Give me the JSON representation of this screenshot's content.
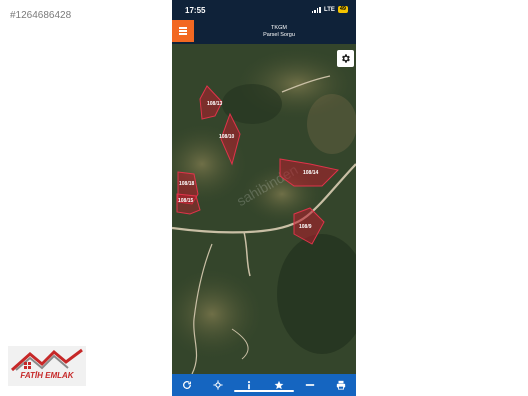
{
  "listing_id": "#1264686428",
  "status_bar": {
    "time": "17:55",
    "network": "LTE",
    "battery": "49"
  },
  "header": {
    "menu_icon": "hamburger-icon",
    "title_line1": "TKGM",
    "title_line2": "Parsel Sorgu",
    "accent_color": "#f26822",
    "bar_color": "#0f2239"
  },
  "map": {
    "settings_icon": "gear-icon",
    "watermark": "sahibinden",
    "parcel_color": "#b71c2c",
    "parcels": [
      "108/13",
      "108/10",
      "108/14",
      "108/18",
      "108/15",
      "108/9"
    ]
  },
  "toolbar": {
    "color": "#1565c0",
    "items": [
      "refresh-icon",
      "locate-icon",
      "info-icon",
      "star-icon",
      "measure-icon",
      "print-icon"
    ]
  },
  "brand": {
    "name": "FATİH EMLAK"
  }
}
